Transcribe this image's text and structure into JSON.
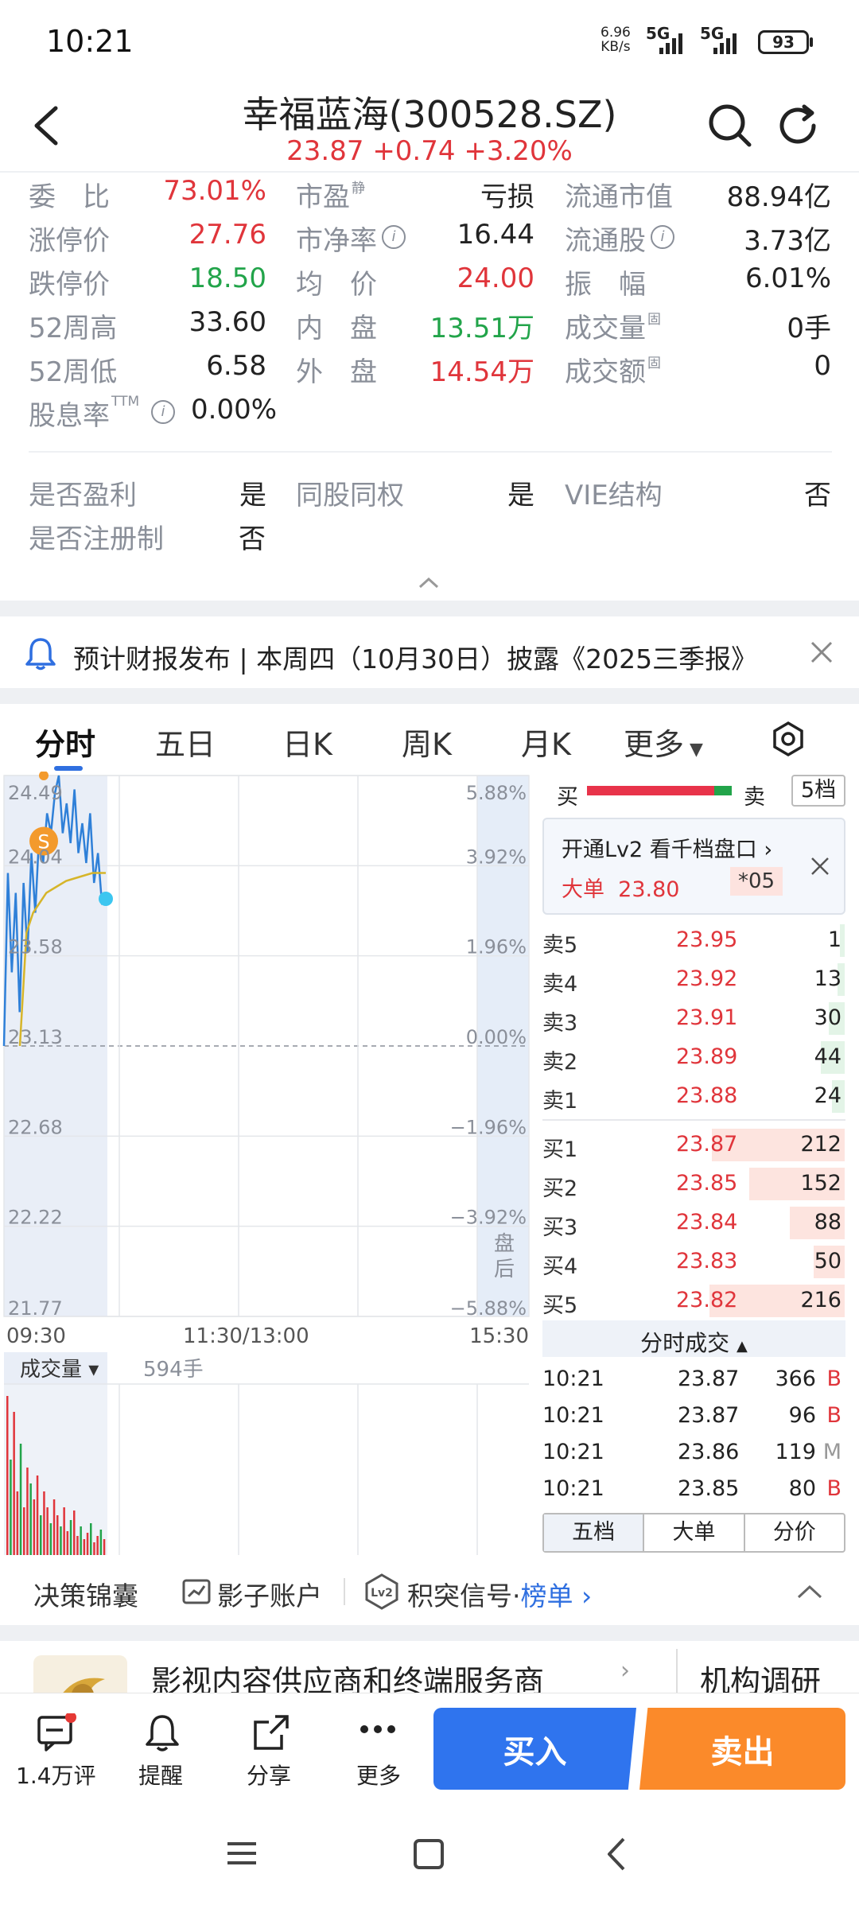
{
  "status": {
    "time": "10:21",
    "net_speed": "6.96",
    "net_unit": "KB/s",
    "sig1": "5G",
    "sig2": "5G",
    "battery": "93"
  },
  "header": {
    "title": "幸福蓝海(300528.SZ)",
    "price": "23.87",
    "change": "+0.74",
    "pct": "+3.20%"
  },
  "stats": [
    [
      {
        "l": "委　比",
        "v": "73.01%",
        "c": "red"
      },
      {
        "l": "市盈",
        "sup": "静",
        "v": "亏损",
        "c": "dark"
      },
      {
        "l": "流通市值",
        "v": "88.94亿",
        "c": "dark"
      }
    ],
    [
      {
        "l": "涨停价",
        "v": "27.76",
        "c": "red"
      },
      {
        "l": "市净率",
        "info": true,
        "v": "16.44",
        "c": "dark"
      },
      {
        "l": "流通股",
        "info": true,
        "v": "3.73亿",
        "c": "dark"
      }
    ],
    [
      {
        "l": "跌停价",
        "v": "18.50",
        "c": "green"
      },
      {
        "l": "均　价",
        "v": "24.00",
        "c": "red"
      },
      {
        "l": "振　幅",
        "v": "6.01%",
        "c": "dark"
      }
    ],
    [
      {
        "l": "52周高",
        "v": "33.60",
        "c": "dark"
      },
      {
        "l": "内　盘",
        "v": "13.51万",
        "c": "green"
      },
      {
        "l": "成交量",
        "sup": "固",
        "v": "0手",
        "c": "dark"
      }
    ],
    [
      {
        "l": "52周低",
        "v": "6.58",
        "c": "dark"
      },
      {
        "l": "外　盘",
        "v": "14.54万",
        "c": "red"
      },
      {
        "l": "成交额",
        "sup": "固",
        "v": "0",
        "c": "dark"
      }
    ]
  ],
  "dividend": {
    "label": "股息率",
    "sup": "TTM",
    "value": "0.00%"
  },
  "flags": [
    [
      {
        "l": "是否盈利",
        "v": "是"
      },
      {
        "l": "同股同权",
        "v": "是"
      },
      {
        "l": "VIE结构",
        "v": "否"
      }
    ],
    [
      {
        "l": "是否注册制",
        "v": "否"
      }
    ]
  ],
  "notice": {
    "text": "预计财报发布 | 本周四（10月30日）披露《2025三季报》"
  },
  "tabs": [
    "分时",
    "五日",
    "日K",
    "周K",
    "月K",
    "更多"
  ],
  "chart": {
    "price_labels": [
      "24.49",
      "24.04",
      "23.58",
      "23.13",
      "22.68",
      "22.22",
      "21.77"
    ],
    "pct_labels": [
      "5.88%",
      "3.92%",
      "1.96%",
      "0.00%",
      "−1.96%",
      "−3.92%",
      "−5.88%"
    ],
    "time_labels": [
      "09:30",
      "11:30/13:00",
      "15:30"
    ],
    "after_hours": "盘后",
    "volume_label": "成交量",
    "volume_value": "594手",
    "price_series": [
      23.13,
      24.0,
      23.5,
      23.9,
      23.3,
      23.95,
      23.6,
      24.1,
      23.8,
      24.2,
      24.05,
      24.3,
      24.2,
      24.4,
      24.49,
      24.2,
      24.35,
      24.15,
      24.42,
      24.1,
      24.25,
      24.05,
      24.3,
      23.95,
      24.1,
      23.85,
      23.87
    ],
    "avg_series": [
      23.13,
      23.7,
      23.8,
      23.85,
      23.9,
      23.92,
      23.94,
      23.96,
      23.97,
      23.98,
      23.99,
      24.0,
      24.0,
      24.0
    ],
    "volume_series": [
      100,
      60,
      90,
      40,
      70,
      30,
      55,
      45,
      35,
      50,
      25,
      40,
      30,
      20,
      35,
      25,
      18,
      30,
      15,
      22,
      28,
      12,
      18,
      10,
      14,
      20,
      8,
      12,
      16,
      10
    ],
    "marker": "S"
  },
  "book": {
    "bar_buy": "买",
    "bar_sell": "卖",
    "levels_btn": "5档",
    "lv2_text": "开通Lv2 看千档盘口",
    "big_label": "大单",
    "big_price": "23.80",
    "big_tag": "*05",
    "asks": [
      {
        "l": "卖5",
        "p": "23.95",
        "v": "1"
      },
      {
        "l": "卖4",
        "p": "23.92",
        "v": "13"
      },
      {
        "l": "卖3",
        "p": "23.91",
        "v": "30"
      },
      {
        "l": "卖2",
        "p": "23.89",
        "v": "44"
      },
      {
        "l": "卖1",
        "p": "23.88",
        "v": "24"
      }
    ],
    "bids": [
      {
        "l": "买1",
        "p": "23.87",
        "v": "212"
      },
      {
        "l": "买2",
        "p": "23.85",
        "v": "152"
      },
      {
        "l": "买3",
        "p": "23.84",
        "v": "88"
      },
      {
        "l": "买4",
        "p": "23.83",
        "v": "50"
      },
      {
        "l": "买5",
        "p": "23.82",
        "v": "216"
      }
    ],
    "trades_title": "分时成交",
    "trades": [
      {
        "t": "10:21",
        "p": "23.87",
        "v": "366",
        "s": "B"
      },
      {
        "t": "10:21",
        "p": "23.87",
        "v": "96",
        "s": "B"
      },
      {
        "t": "10:21",
        "p": "23.86",
        "v": "119",
        "s": "M"
      },
      {
        "t": "10:21",
        "p": "23.85",
        "v": "80",
        "s": "B"
      }
    ],
    "sub_tabs": [
      "五档",
      "大单",
      "分价"
    ]
  },
  "tools": {
    "t1": "决策锦囊",
    "t2": "影子账户",
    "t3": "积突信号",
    "t3b": "榜单"
  },
  "news": {
    "title": "影视内容供应商和终端服务商",
    "tag": "机构调研"
  },
  "bottom": {
    "comment": "1.4万评",
    "remind": "提醒",
    "share": "分享",
    "more": "更多",
    "buy": "买入",
    "sell": "卖出"
  }
}
